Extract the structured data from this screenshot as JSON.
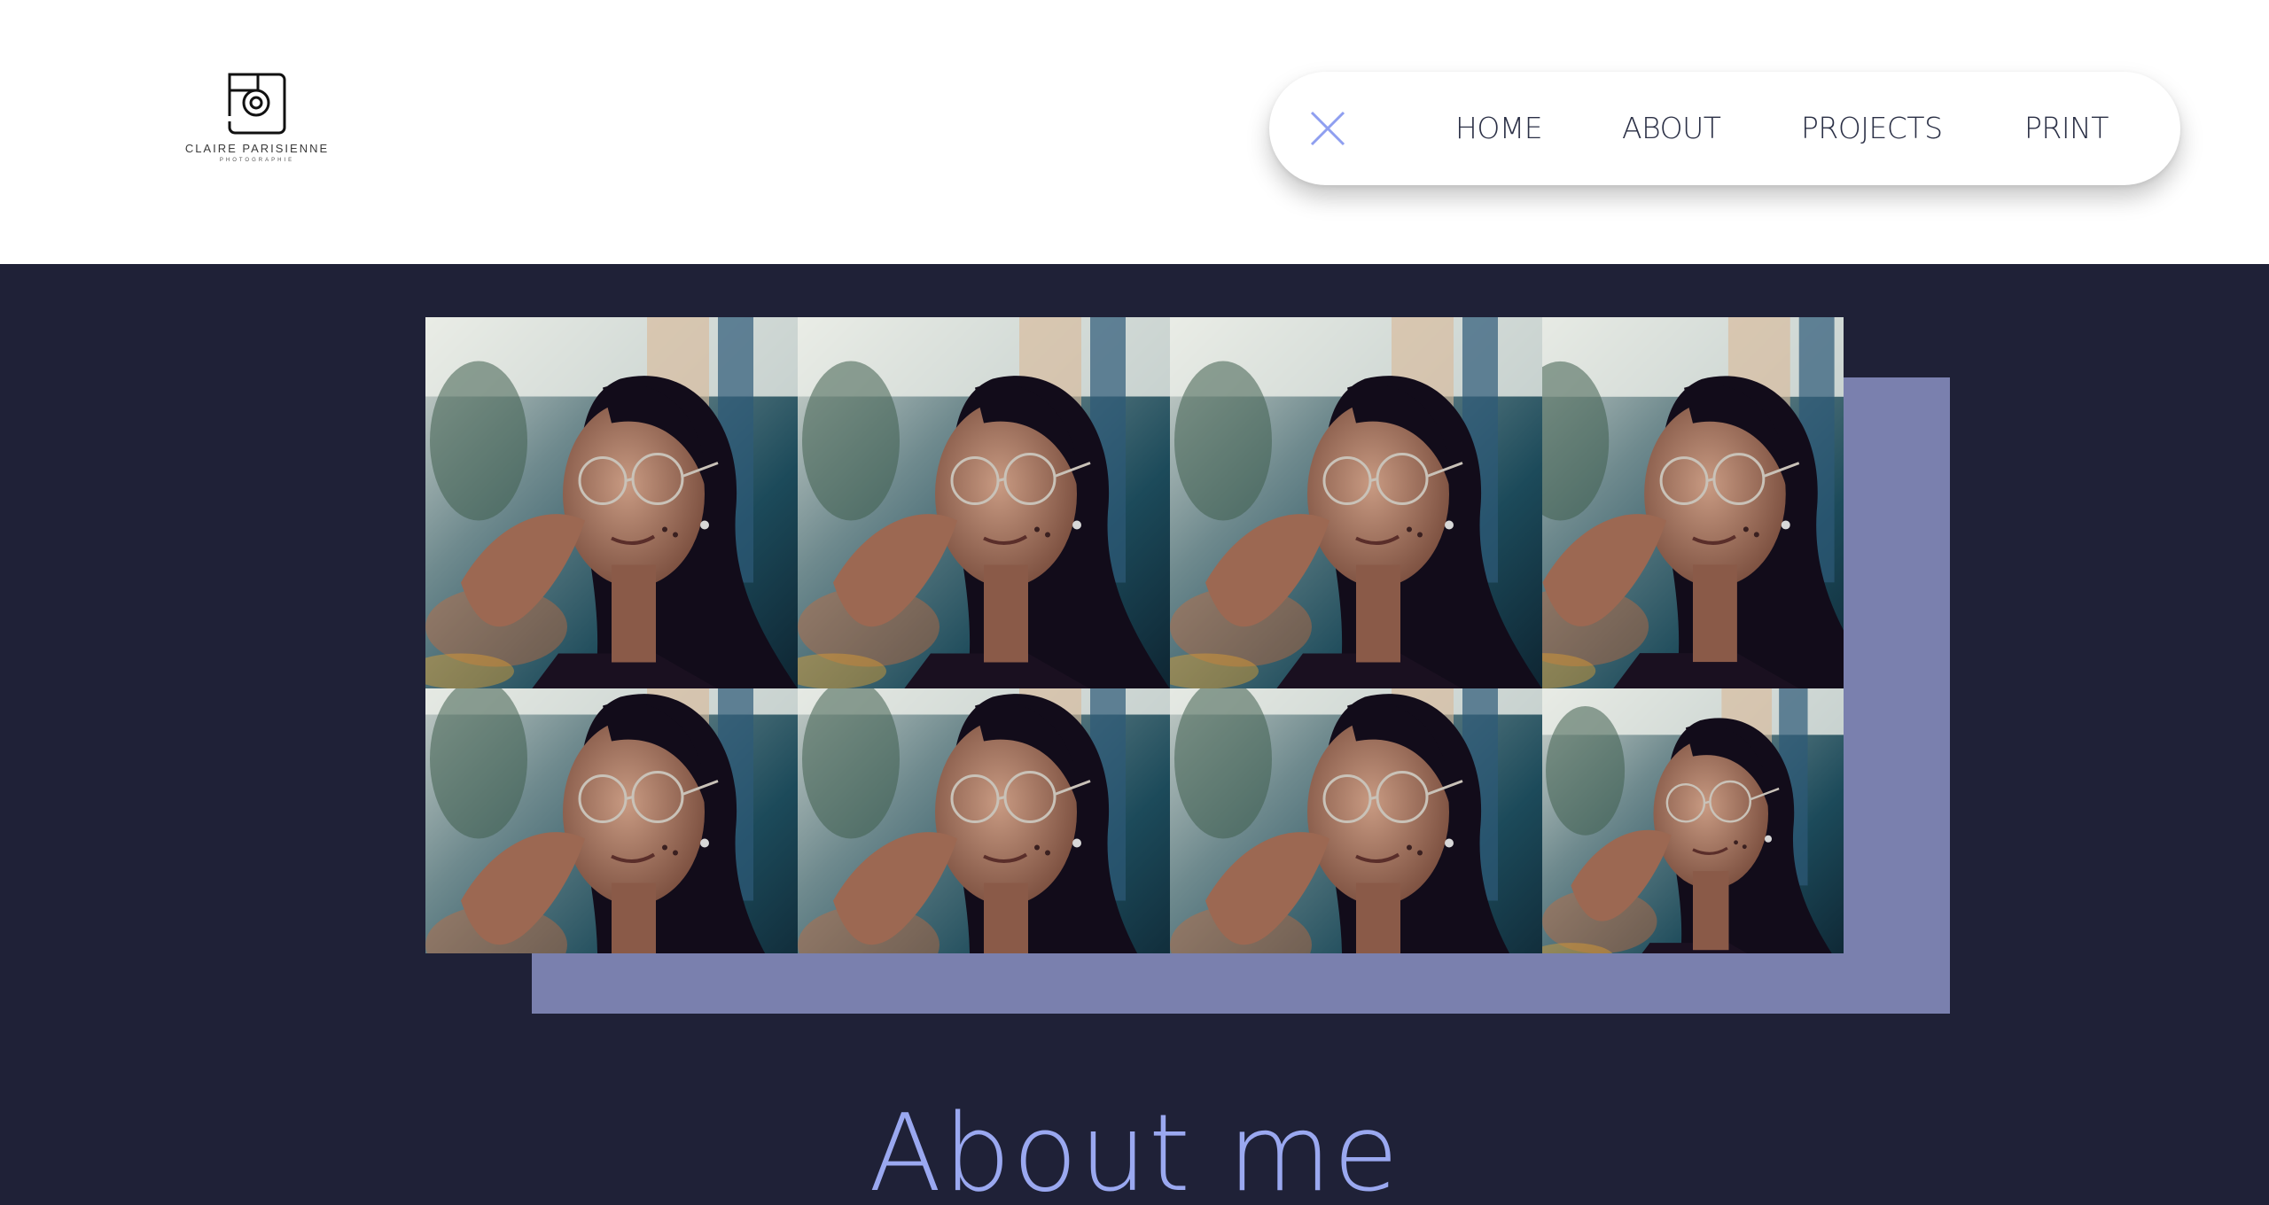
{
  "brand": {
    "name": "CLAIRE PARISIENNE",
    "tagline": "PHOTOGRAPHIE",
    "logo_icon": "camera-icon"
  },
  "nav": {
    "close_icon": "close-icon",
    "items": [
      {
        "label": "HOME"
      },
      {
        "label": "ABOUT"
      },
      {
        "label": "PROJECTS"
      },
      {
        "label": "PRINT"
      }
    ]
  },
  "gallery": {
    "rows": 2,
    "columns": 4,
    "photos": [
      {
        "subject": "portrait of woman with glasses"
      },
      {
        "subject": "portrait of woman with glasses"
      },
      {
        "subject": "portrait of woman with glasses"
      },
      {
        "subject": "portrait of woman with glasses"
      },
      {
        "subject": "portrait of woman with glasses"
      },
      {
        "subject": "portrait of woman with glasses"
      },
      {
        "subject": "portrait of woman with glasses"
      },
      {
        "subject": "portrait of woman with glasses"
      }
    ]
  },
  "about": {
    "title": "About me"
  },
  "colors": {
    "background_dark": "#1f2137",
    "accent_block": "#7a80ae",
    "title_accent": "#9aa8f0",
    "nav_text": "#2a2f45",
    "close_icon": "#8f9ff0"
  }
}
